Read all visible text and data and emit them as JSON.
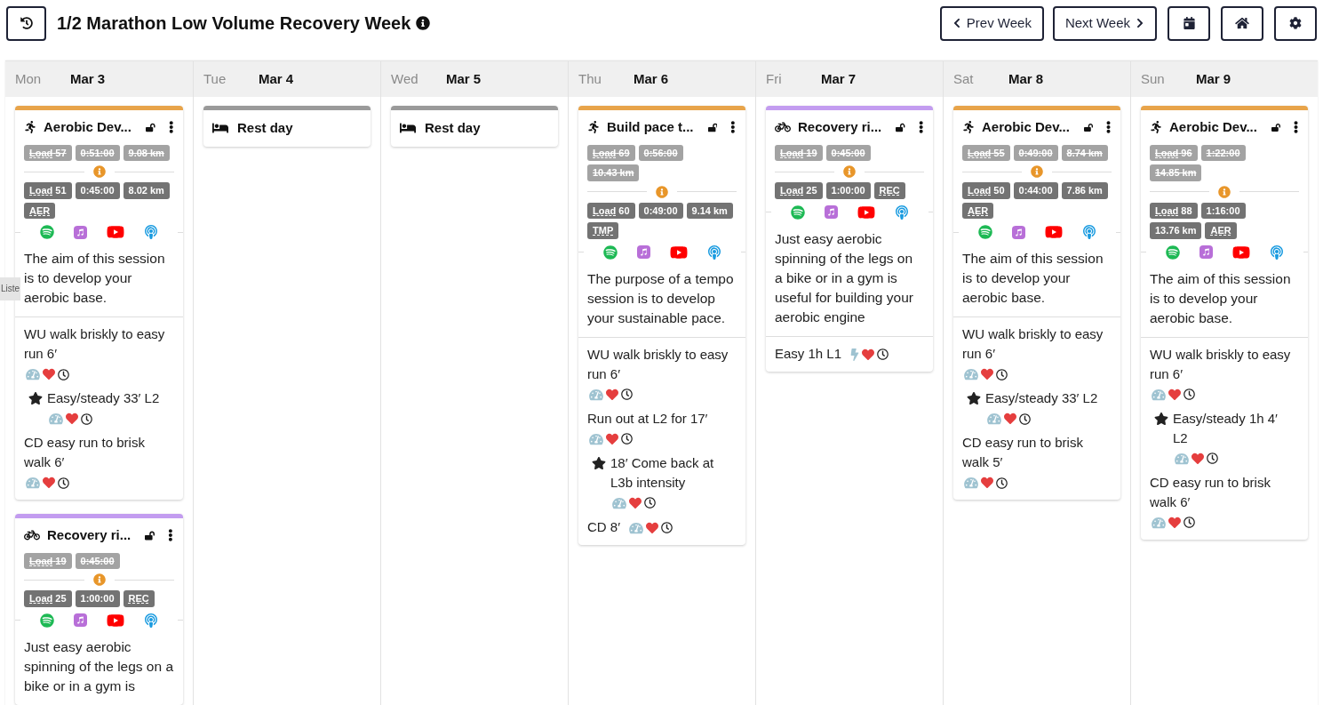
{
  "title": "1/2 Marathon Low Volume Recovery Week",
  "nav": {
    "prev": "Prev Week",
    "next": "Next Week"
  },
  "tooltip": "Liste",
  "days": [
    {
      "dow": "Mon",
      "date": "Mar 3",
      "sessions": [
        {
          "kind": "run",
          "color": "#e8a44a",
          "title": "Aerobic Dev...",
          "locked": false,
          "planned": [
            {
              "kind": "load",
              "label": "Load",
              "value": "57"
            },
            {
              "kind": "plain",
              "value": "0:51:00"
            },
            {
              "kind": "plain",
              "value": "9.08 km"
            }
          ],
          "actual": [
            {
              "kind": "load",
              "label": "Load",
              "value": "51"
            },
            {
              "kind": "plain",
              "value": "0:45:00"
            },
            {
              "kind": "plain",
              "value": "8.02 km"
            },
            {
              "kind": "zone",
              "value": "AER"
            }
          ],
          "description": "The aim of this session is to develop your aerobic base.",
          "steps": [
            {
              "text": "WU walk briskly to easy run 6′",
              "key": false,
              "kind": "gauge"
            },
            {
              "text": "Easy/steady 33′ L2",
              "key": true,
              "kind": "gauge"
            },
            {
              "text": "CD easy run to brisk walk 6′",
              "key": false,
              "kind": "gauge"
            }
          ]
        },
        {
          "kind": "ride",
          "color": "#c39cf0",
          "title": "Recovery ri...",
          "locked": false,
          "planned": [
            {
              "kind": "load",
              "label": "Load",
              "value": "19"
            },
            {
              "kind": "plain",
              "value": "0:45:00"
            }
          ],
          "actual": [
            {
              "kind": "load",
              "label": "Load",
              "value": "25"
            },
            {
              "kind": "plain",
              "value": "1:00:00"
            },
            {
              "kind": "zone",
              "value": "REC"
            }
          ],
          "description": "Just easy aerobic spinning of the legs on a bike or in a gym is"
        }
      ]
    },
    {
      "dow": "Tue",
      "date": "Mar 4",
      "sessions": [
        {
          "kind": "rest",
          "color": "#9a9a9a",
          "title": "Rest day"
        }
      ]
    },
    {
      "dow": "Wed",
      "date": "Mar 5",
      "sessions": [
        {
          "kind": "rest",
          "color": "#9a9a9a",
          "title": "Rest day"
        }
      ]
    },
    {
      "dow": "Thu",
      "date": "Mar 6",
      "sessions": [
        {
          "kind": "run",
          "color": "#e8a44a",
          "title": "Build pace t...",
          "locked": false,
          "planned": [
            {
              "kind": "load",
              "label": "Load",
              "value": "69"
            },
            {
              "kind": "plain",
              "value": "0:56:00"
            },
            {
              "kind": "plain",
              "value": "10.43 km"
            }
          ],
          "actual": [
            {
              "kind": "load",
              "label": "Load",
              "value": "60"
            },
            {
              "kind": "plain",
              "value": "0:49:00"
            },
            {
              "kind": "plain",
              "value": "9.14 km"
            },
            {
              "kind": "zone",
              "value": "TMP"
            }
          ],
          "description": "The purpose of a tempo session is to develop your sustainable pace.",
          "steps": [
            {
              "text": "WU walk briskly to easy run 6′",
              "key": false,
              "kind": "gauge"
            },
            {
              "text": "Run out at L2 for 17′",
              "key": false,
              "kind": "gauge"
            },
            {
              "text": "18′ Come back at L3b intensity",
              "key": true,
              "kind": "gauge"
            },
            {
              "text": "CD 8′",
              "key": false,
              "kind": "gauge"
            }
          ]
        }
      ]
    },
    {
      "dow": "Fri",
      "date": "Mar 7",
      "sessions": [
        {
          "kind": "ride",
          "color": "#c39cf0",
          "title": "Recovery ri...",
          "locked": false,
          "planned": [
            {
              "kind": "load",
              "label": "Load",
              "value": "19"
            },
            {
              "kind": "plain",
              "value": "0:45:00"
            }
          ],
          "actual": [
            {
              "kind": "load",
              "label": "Load",
              "value": "25"
            },
            {
              "kind": "plain",
              "value": "1:00:00"
            },
            {
              "kind": "zone",
              "value": "REC"
            }
          ],
          "description": "Just easy aerobic spinning of the legs on a bike or in a gym is useful for building your aerobic engine",
          "steps": [
            {
              "text": "Easy 1h L1",
              "key": false,
              "kind": "bolt"
            }
          ]
        }
      ]
    },
    {
      "dow": "Sat",
      "date": "Mar 8",
      "sessions": [
        {
          "kind": "run",
          "color": "#e8a44a",
          "title": "Aerobic Dev...",
          "locked": false,
          "planned": [
            {
              "kind": "load",
              "label": "Load",
              "value": "55"
            },
            {
              "kind": "plain",
              "value": "0:49:00"
            },
            {
              "kind": "plain",
              "value": "8.74 km"
            }
          ],
          "actual": [
            {
              "kind": "load",
              "label": "Load",
              "value": "50"
            },
            {
              "kind": "plain",
              "value": "0:44:00"
            },
            {
              "kind": "plain",
              "value": "7.86 km"
            },
            {
              "kind": "zone",
              "value": "AER"
            }
          ],
          "description": "The aim of this session is to develop your aerobic base.",
          "steps": [
            {
              "text": "WU walk briskly to easy run 6′",
              "key": false,
              "kind": "gauge"
            },
            {
              "text": "Easy/steady 33′ L2",
              "key": true,
              "kind": "gauge"
            },
            {
              "text": "CD easy run to brisk walk 5′",
              "key": false,
              "kind": "gauge"
            }
          ]
        }
      ]
    },
    {
      "dow": "Sun",
      "date": "Mar 9",
      "sessions": [
        {
          "kind": "run",
          "color": "#e8a44a",
          "title": "Aerobic Dev...",
          "locked": false,
          "planned": [
            {
              "kind": "load",
              "label": "Load",
              "value": "96"
            },
            {
              "kind": "plain",
              "value": "1:22:00"
            },
            {
              "kind": "plain",
              "value": "14.85 km"
            }
          ],
          "actual": [
            {
              "kind": "load",
              "label": "Load",
              "value": "88"
            },
            {
              "kind": "plain",
              "value": "1:16:00"
            },
            {
              "kind": "plain",
              "value": "13.76 km"
            },
            {
              "kind": "zone",
              "value": "AER"
            }
          ],
          "description": "The aim of this session is to develop your aerobic base.",
          "steps": [
            {
              "text": "WU walk briskly to easy run 6′",
              "key": false,
              "kind": "gauge"
            },
            {
              "text": "Easy/steady 1h 4′ L2",
              "key": true,
              "kind": "gauge"
            },
            {
              "text": "CD easy run to brisk walk 6′",
              "key": false,
              "kind": "gauge"
            }
          ]
        }
      ]
    }
  ]
}
